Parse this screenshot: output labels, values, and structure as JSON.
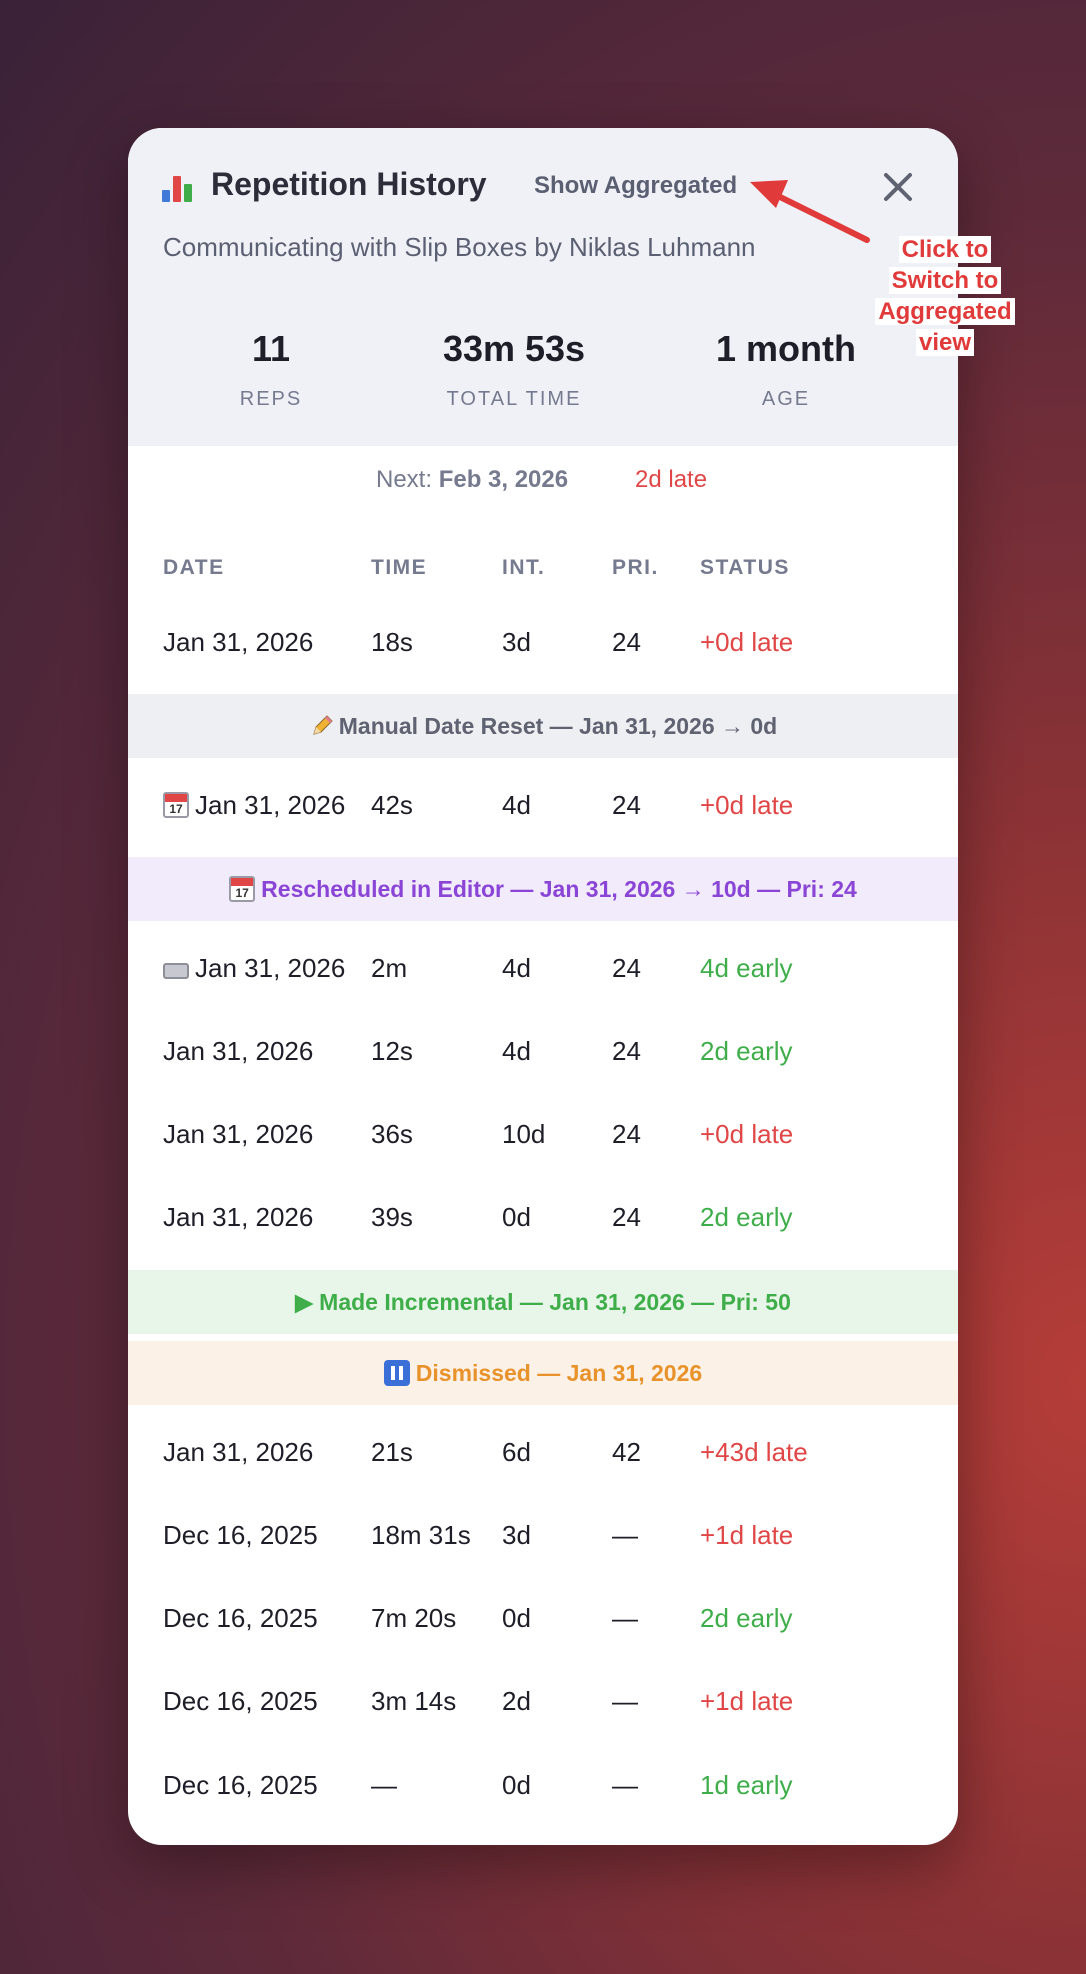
{
  "header": {
    "title": "Repetition History",
    "toggle_label": "Show Aggregated",
    "subtitle": "Communicating with Slip Boxes by Niklas Luhmann"
  },
  "stats": [
    {
      "value": "11",
      "label": "REPS"
    },
    {
      "value": "33m 53s",
      "label": "TOTAL TIME"
    },
    {
      "value": "1 month",
      "label": "AGE"
    }
  ],
  "next": {
    "label": "Next:",
    "date": "Feb 3, 2026",
    "status": "2d late"
  },
  "columns": [
    "DATE",
    "TIME",
    "INT.",
    "PRI.",
    "STATUS"
  ],
  "rows": [
    {
      "date": "Jan 31, 2026",
      "time": "18s",
      "int": "3d",
      "pri": "24",
      "status": "+0d late"
    },
    {
      "band": "Manual Date Reset — Jan 31, 2026 → 0d"
    },
    {
      "date": "Jan 31, 2026",
      "time": "42s",
      "int": "4d",
      "pri": "24",
      "status": "+0d late"
    },
    {
      "band": "Rescheduled in Editor — Jan 31, 2026 → 10d — Pri: 24"
    },
    {
      "date": "Jan 31, 2026",
      "time": "2m",
      "int": "4d",
      "pri": "24",
      "status": "4d early"
    },
    {
      "date": "Jan 31, 2026",
      "time": "12s",
      "int": "4d",
      "pri": "24",
      "status": "2d early"
    },
    {
      "date": "Jan 31, 2026",
      "time": "36s",
      "int": "10d",
      "pri": "24",
      "status": "+0d late"
    },
    {
      "date": "Jan 31, 2026",
      "time": "39s",
      "int": "0d",
      "pri": "24",
      "status": "2d early"
    },
    {
      "band": "▶ Made Incremental — Jan 31, 2026 — Pri: 50"
    },
    {
      "band": "Dismissed — Jan 31, 2026"
    },
    {
      "date": "Jan 31, 2026",
      "time": "21s",
      "int": "6d",
      "pri": "42",
      "status": "+43d late"
    },
    {
      "date": "Dec 16, 2025",
      "time": "18m 31s",
      "int": "3d",
      "pri": "—",
      "status": "+1d late"
    },
    {
      "date": "Dec 16, 2025",
      "time": "7m 20s",
      "int": "0d",
      "pri": "—",
      "status": "2d early"
    },
    {
      "date": "Dec 16, 2025",
      "time": "3m 14s",
      "int": "2d",
      "pri": "—",
      "status": "+1d late"
    },
    {
      "date": "Dec 16, 2025",
      "time": "—",
      "int": "0d",
      "pri": "—",
      "status": "1d early"
    }
  ],
  "annotation": [
    "Click to",
    "Switch to",
    "Aggregated",
    "view"
  ],
  "colors": {
    "late": "#e04646",
    "early": "#3fae4a",
    "reset_band": "#eeeff2",
    "reschedule_band": "#f1ebfb",
    "incremental_band": "#e8f6ea",
    "dismissed_band": "#fcf1e6",
    "annotation": "#e03a3a"
  },
  "icons": [
    "bar-chart-icon",
    "close-icon",
    "pencil-icon",
    "calendar-icon",
    "keyboard-icon",
    "pause-icon",
    "arrow-annotation-icon"
  ]
}
